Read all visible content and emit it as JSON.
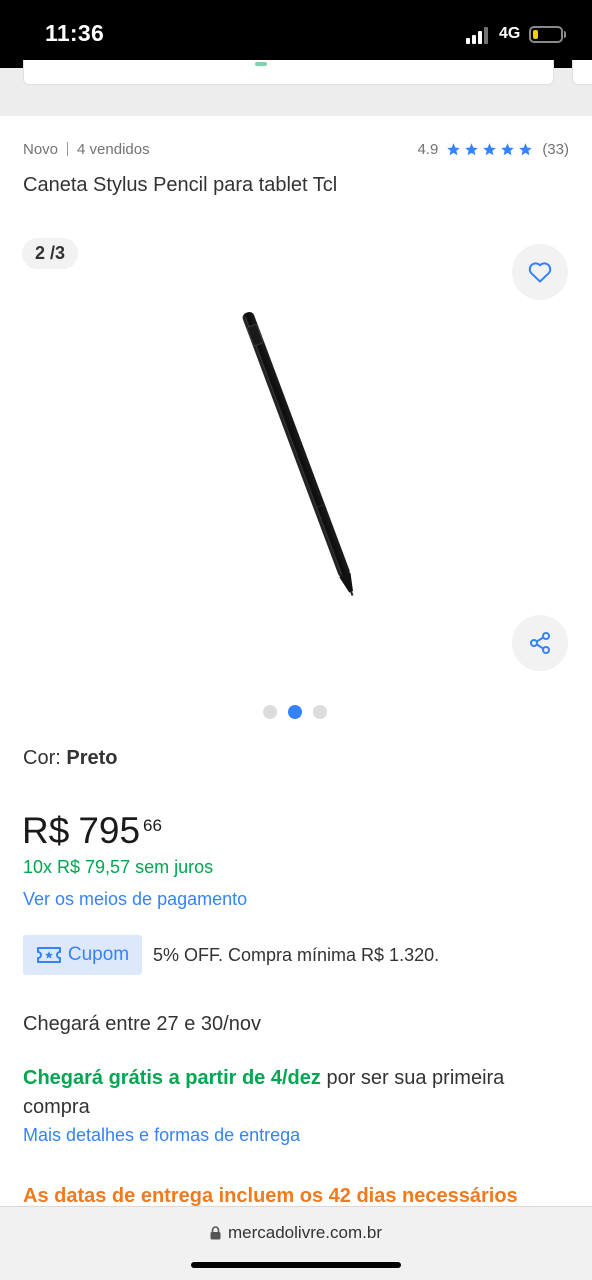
{
  "status_bar": {
    "time": "11:36",
    "network": "4G"
  },
  "product": {
    "condition": "Novo",
    "sold": "4 vendidos",
    "rating": "4.9",
    "reviews": "(33)",
    "stars": 5,
    "title": "Caneta Stylus Pencil para tablet Tcl"
  },
  "gallery": {
    "counter": "2 /3",
    "dots_total": 3,
    "active_dot": 2
  },
  "color": {
    "label": "Cor:",
    "value": "Preto"
  },
  "price": {
    "currency": "R$",
    "integer": "795",
    "cents": "66",
    "installments": "10x R$ 79,57 sem juros",
    "payment_link": "Ver os meios de pagamento"
  },
  "coupon": {
    "label": "Cupom",
    "description": "5% OFF. Compra mínima R$ 1.320."
  },
  "shipping": {
    "arrival": "Chegará entre 27 e 30/nov",
    "free_highlight": "Chegará grátis a partir de 4/dez",
    "free_rest": " por ser sua primeira compra",
    "details_link": "Mais detalhes e formas de entrega",
    "warning": "As datas de entrega incluem os 42 dias necessários"
  },
  "browser": {
    "url": "mercadolivre.com.br"
  },
  "colors": {
    "accent": "#3483fa",
    "green": "#00a650",
    "orange": "#f27a1e"
  },
  "icons": [
    "heart-icon",
    "share-icon",
    "star-icon",
    "ticket-icon",
    "lock-icon"
  ]
}
